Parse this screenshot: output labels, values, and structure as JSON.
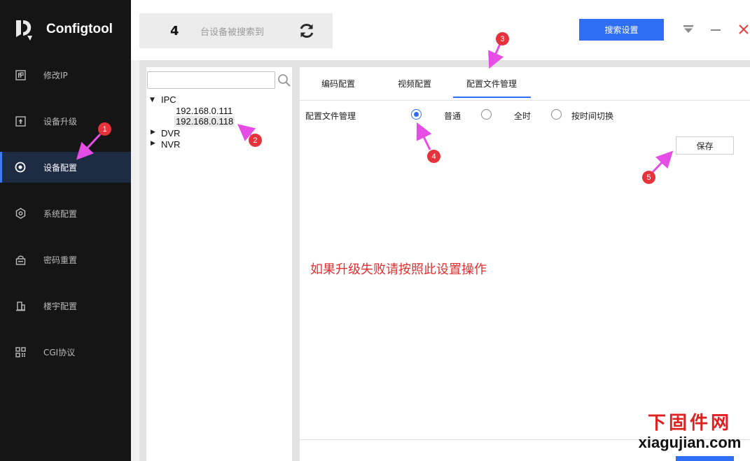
{
  "app": {
    "name": "Configtool"
  },
  "sidebar": {
    "items": [
      {
        "label": "修改IP",
        "icon": "ip-icon"
      },
      {
        "label": "设备升级",
        "icon": "upgrade-icon"
      },
      {
        "label": "设备配置",
        "icon": "target-icon",
        "active": true
      },
      {
        "label": "系统配置",
        "icon": "hexagon-icon"
      },
      {
        "label": "密码重置",
        "icon": "lock-icon"
      },
      {
        "label": "楼宇配置",
        "icon": "building-icon"
      },
      {
        "label": "CGI协议",
        "icon": "grid-icon"
      }
    ]
  },
  "topbar": {
    "device_count": "4",
    "device_count_text": "台设备被搜索到",
    "search_settings_label": "搜索设置"
  },
  "tree": {
    "search_placeholder": "",
    "groups": [
      {
        "label": "IPC",
        "expanded": true,
        "children": [
          "192.168.0.111",
          "192.168.0.118"
        ]
      },
      {
        "label": "DVR",
        "expanded": false
      },
      {
        "label": "NVR",
        "expanded": false
      }
    ]
  },
  "tabs": [
    {
      "label": "编码配置"
    },
    {
      "label": "视频配置"
    },
    {
      "label": "配置文件管理",
      "active": true
    }
  ],
  "profile": {
    "field_label": "配置文件管理",
    "options": [
      {
        "label": "普通",
        "checked": true
      },
      {
        "label": "全时",
        "checked": false
      },
      {
        "label": "按时间切换",
        "checked": false
      }
    ],
    "save_label": "保存"
  },
  "note": "如果升级失败请按照此设置操作",
  "annotations": [
    "1",
    "2",
    "3",
    "4",
    "5"
  ],
  "watermark": {
    "cn": "下固件网",
    "en": "xiagujian.com"
  },
  "colors": {
    "accent": "#2f6ef5",
    "annotation": "#e5323b",
    "arrow": "#e64ce6",
    "note": "#e03030",
    "sidebar": "#151515"
  }
}
